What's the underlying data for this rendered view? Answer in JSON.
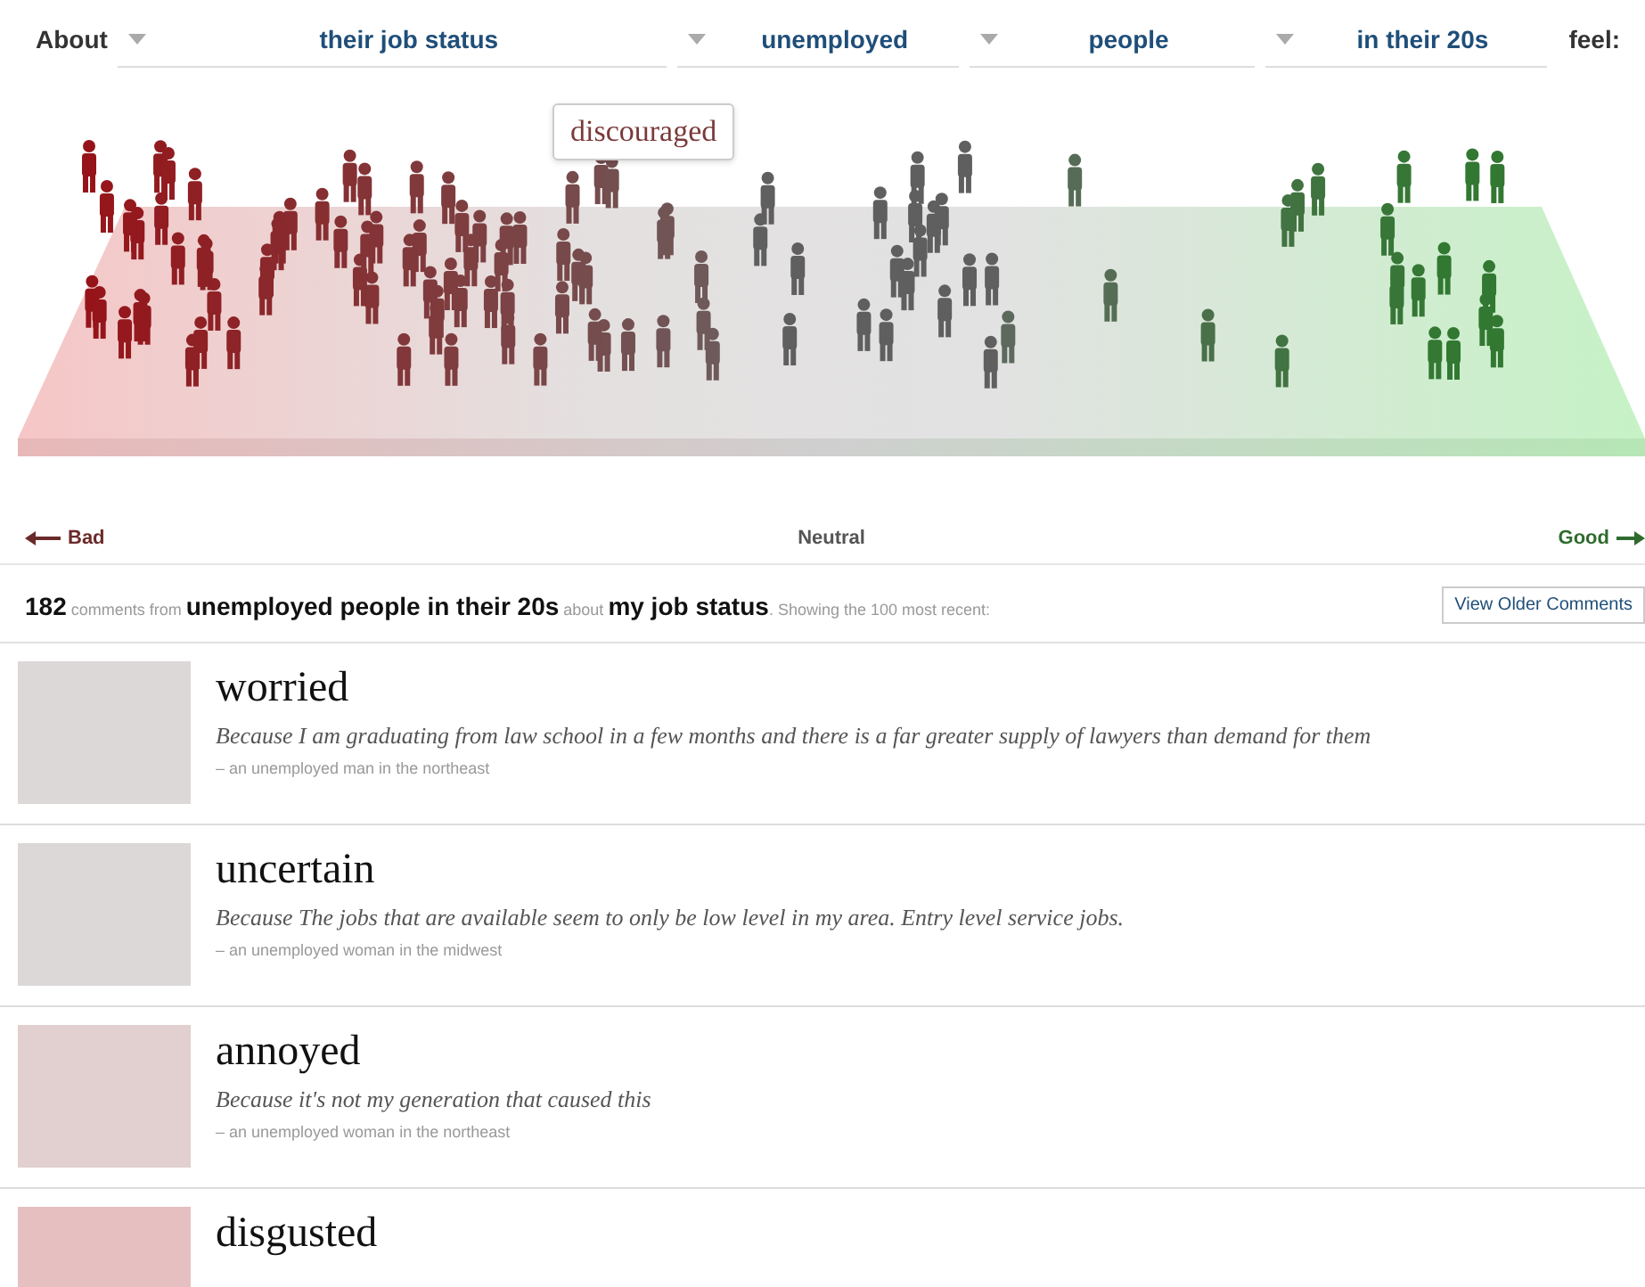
{
  "filter_bar": {
    "lead": "About",
    "dropdowns": [
      {
        "value": "their job status"
      },
      {
        "value": "unemployed"
      },
      {
        "value": "people"
      },
      {
        "value": "in their 20s"
      }
    ],
    "tail": "feel:"
  },
  "chart_tooltip": "discouraged",
  "scale": {
    "bad": "Bad",
    "neutral": "Neutral",
    "good": "Good"
  },
  "summary": {
    "text": "**182** comments from **unemployed people in their 20s** about **my job status**. Showing the 100 most recent:",
    "button": "View Older Comments"
  },
  "comments": [
    {
      "feeling": "worried",
      "color": "#dbd8d7",
      "reason": "Because I am graduating from law school in a few months and there is a far greater supply of lawyers than demand for them",
      "author": "– an unemployed man in the northeast"
    },
    {
      "feeling": "uncertain",
      "color": "#dbd8d7",
      "reason": "Because The jobs that are available seem to only be low level in my area. Entry level service jobs.",
      "author": "– an unemployed woman in the midwest"
    },
    {
      "feeling": "annoyed",
      "color": "#e2cfcf",
      "reason": "Because it's not my generation that caused this",
      "author": "– an unemployed woman in the northeast"
    },
    {
      "feeling": "disgusted",
      "color": "#e6c0c0"
    }
  ]
}
